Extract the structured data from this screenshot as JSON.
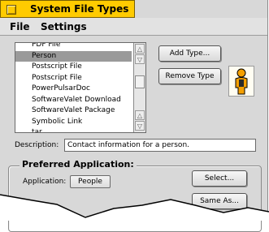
{
  "window": {
    "title": "System File Types"
  },
  "menubar": {
    "items": [
      "File",
      "Settings"
    ]
  },
  "file_types": {
    "items": [
      "PDF File",
      "Person",
      "Postscript File",
      "Postscript File",
      "PowerPulsarDoc",
      "SoftwareValet Download",
      "SoftwareValet Package",
      "Symbolic Link",
      "tar"
    ],
    "selected": "Person"
  },
  "buttons": {
    "add_type": "Add Type...",
    "remove_type": "Remove Type",
    "select": "Select...",
    "same_as": "Same As..."
  },
  "description": {
    "label": "Description:",
    "value": "Contact information for a person."
  },
  "preferred_application": {
    "title": "Preferred Application:",
    "label": "Application:",
    "value": "People"
  },
  "icons": {
    "type_icon": "person-icon",
    "close": "close-box-icon",
    "scroll_up": "scroll-up-arrow-icon",
    "scroll_down": "scroll-down-arrow-icon"
  },
  "colors": {
    "title_tab": "#ffcb00",
    "window_bg": "#d8d8d8",
    "selection": "#9a9a9a",
    "person_icon": "#f5a000"
  }
}
